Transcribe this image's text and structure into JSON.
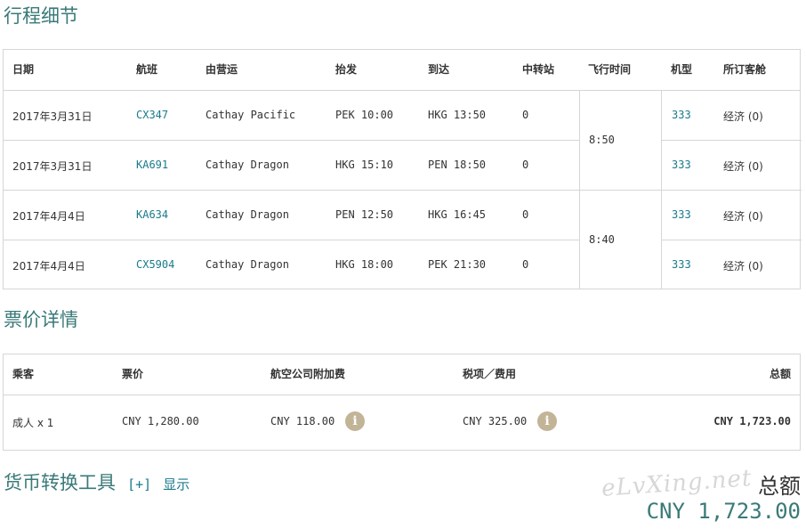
{
  "itinerary": {
    "title": "行程细节",
    "headers": [
      "日期",
      "航班",
      "由营运",
      "抬发",
      "到达",
      "中转站",
      "飞行时间",
      "机型",
      "所订客舱"
    ],
    "rows": [
      {
        "date": "2017年3月31日",
        "flight": "CX347",
        "operator": "Cathay Pacific",
        "depart": "PEK 10:00",
        "arrive": "HKG 13:50",
        "stops": "0",
        "aircraft": "333",
        "cabin": "经济 (0)"
      },
      {
        "date": "2017年3月31日",
        "flight": "KA691",
        "operator": "Cathay Dragon",
        "depart": "HKG 15:10",
        "arrive": "PEN 18:50",
        "stops": "0",
        "aircraft": "333",
        "cabin": "经济 (0)"
      },
      {
        "date": "2017年4月4日",
        "flight": "KA634",
        "operator": "Cathay Dragon",
        "depart": "PEN 12:50",
        "arrive": "HKG 16:45",
        "stops": "0",
        "aircraft": "333",
        "cabin": "经济 (0)"
      },
      {
        "date": "2017年4月4日",
        "flight": "CX5904",
        "operator": "Cathay Dragon",
        "depart": "HKG 18:00",
        "arrive": "PEK 21:30",
        "stops": "0",
        "aircraft": "333",
        "cabin": "经济 (0)"
      }
    ],
    "durations": [
      "8:50",
      "8:40"
    ]
  },
  "fare": {
    "title": "票价详情",
    "headers": {
      "passenger": "乘客",
      "fare": "票价",
      "surcharge": "航空公司附加费",
      "tax": "税项／费用",
      "total": "总额"
    },
    "row": {
      "passenger": "成人 x 1",
      "fare": "CNY 1,280.00",
      "surcharge": "CNY 118.00",
      "tax": "CNY 325.00",
      "total": "CNY 1,723.00"
    },
    "info_icon": "i"
  },
  "converter": {
    "title": "货币转换工具",
    "toggle": "[+]",
    "show": "显示"
  },
  "summary": {
    "label": "总额",
    "amount": "CNY 1,723.00"
  },
  "watermark": "eLvXing.net"
}
